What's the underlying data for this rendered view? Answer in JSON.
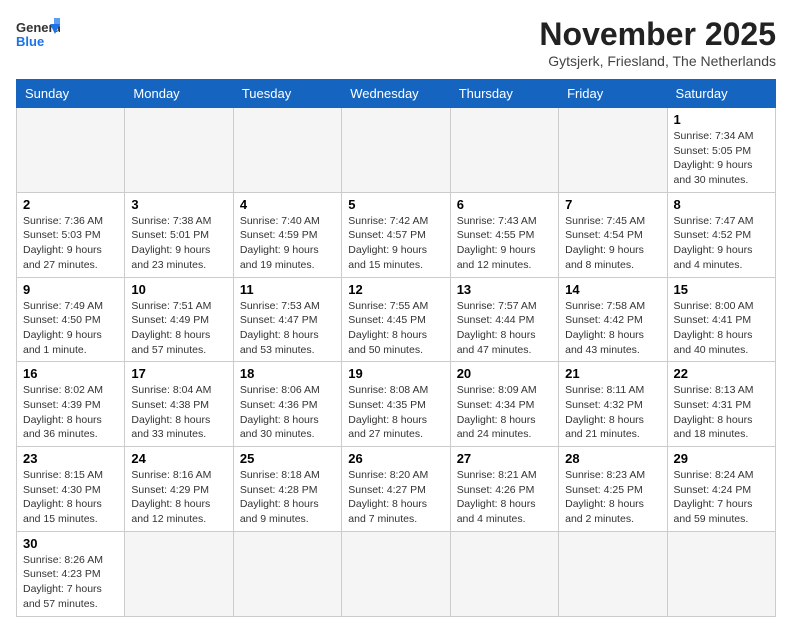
{
  "header": {
    "logo_general": "General",
    "logo_blue": "Blue",
    "month": "November 2025",
    "location": "Gytsjerk, Friesland, The Netherlands"
  },
  "weekdays": [
    "Sunday",
    "Monday",
    "Tuesday",
    "Wednesday",
    "Thursday",
    "Friday",
    "Saturday"
  ],
  "weeks": [
    [
      {
        "day": null,
        "info": ""
      },
      {
        "day": null,
        "info": ""
      },
      {
        "day": null,
        "info": ""
      },
      {
        "day": null,
        "info": ""
      },
      {
        "day": null,
        "info": ""
      },
      {
        "day": null,
        "info": ""
      },
      {
        "day": "1",
        "info": "Sunrise: 7:34 AM\nSunset: 5:05 PM\nDaylight: 9 hours\nand 30 minutes."
      }
    ],
    [
      {
        "day": "2",
        "info": "Sunrise: 7:36 AM\nSunset: 5:03 PM\nDaylight: 9 hours\nand 27 minutes."
      },
      {
        "day": "3",
        "info": "Sunrise: 7:38 AM\nSunset: 5:01 PM\nDaylight: 9 hours\nand 23 minutes."
      },
      {
        "day": "4",
        "info": "Sunrise: 7:40 AM\nSunset: 4:59 PM\nDaylight: 9 hours\nand 19 minutes."
      },
      {
        "day": "5",
        "info": "Sunrise: 7:42 AM\nSunset: 4:57 PM\nDaylight: 9 hours\nand 15 minutes."
      },
      {
        "day": "6",
        "info": "Sunrise: 7:43 AM\nSunset: 4:55 PM\nDaylight: 9 hours\nand 12 minutes."
      },
      {
        "day": "7",
        "info": "Sunrise: 7:45 AM\nSunset: 4:54 PM\nDaylight: 9 hours\nand 8 minutes."
      },
      {
        "day": "8",
        "info": "Sunrise: 7:47 AM\nSunset: 4:52 PM\nDaylight: 9 hours\nand 4 minutes."
      }
    ],
    [
      {
        "day": "9",
        "info": "Sunrise: 7:49 AM\nSunset: 4:50 PM\nDaylight: 9 hours\nand 1 minute."
      },
      {
        "day": "10",
        "info": "Sunrise: 7:51 AM\nSunset: 4:49 PM\nDaylight: 8 hours\nand 57 minutes."
      },
      {
        "day": "11",
        "info": "Sunrise: 7:53 AM\nSunset: 4:47 PM\nDaylight: 8 hours\nand 53 minutes."
      },
      {
        "day": "12",
        "info": "Sunrise: 7:55 AM\nSunset: 4:45 PM\nDaylight: 8 hours\nand 50 minutes."
      },
      {
        "day": "13",
        "info": "Sunrise: 7:57 AM\nSunset: 4:44 PM\nDaylight: 8 hours\nand 47 minutes."
      },
      {
        "day": "14",
        "info": "Sunrise: 7:58 AM\nSunset: 4:42 PM\nDaylight: 8 hours\nand 43 minutes."
      },
      {
        "day": "15",
        "info": "Sunrise: 8:00 AM\nSunset: 4:41 PM\nDaylight: 8 hours\nand 40 minutes."
      }
    ],
    [
      {
        "day": "16",
        "info": "Sunrise: 8:02 AM\nSunset: 4:39 PM\nDaylight: 8 hours\nand 36 minutes."
      },
      {
        "day": "17",
        "info": "Sunrise: 8:04 AM\nSunset: 4:38 PM\nDaylight: 8 hours\nand 33 minutes."
      },
      {
        "day": "18",
        "info": "Sunrise: 8:06 AM\nSunset: 4:36 PM\nDaylight: 8 hours\nand 30 minutes."
      },
      {
        "day": "19",
        "info": "Sunrise: 8:08 AM\nSunset: 4:35 PM\nDaylight: 8 hours\nand 27 minutes."
      },
      {
        "day": "20",
        "info": "Sunrise: 8:09 AM\nSunset: 4:34 PM\nDaylight: 8 hours\nand 24 minutes."
      },
      {
        "day": "21",
        "info": "Sunrise: 8:11 AM\nSunset: 4:32 PM\nDaylight: 8 hours\nand 21 minutes."
      },
      {
        "day": "22",
        "info": "Sunrise: 8:13 AM\nSunset: 4:31 PM\nDaylight: 8 hours\nand 18 minutes."
      }
    ],
    [
      {
        "day": "23",
        "info": "Sunrise: 8:15 AM\nSunset: 4:30 PM\nDaylight: 8 hours\nand 15 minutes."
      },
      {
        "day": "24",
        "info": "Sunrise: 8:16 AM\nSunset: 4:29 PM\nDaylight: 8 hours\nand 12 minutes."
      },
      {
        "day": "25",
        "info": "Sunrise: 8:18 AM\nSunset: 4:28 PM\nDaylight: 8 hours\nand 9 minutes."
      },
      {
        "day": "26",
        "info": "Sunrise: 8:20 AM\nSunset: 4:27 PM\nDaylight: 8 hours\nand 7 minutes."
      },
      {
        "day": "27",
        "info": "Sunrise: 8:21 AM\nSunset: 4:26 PM\nDaylight: 8 hours\nand 4 minutes."
      },
      {
        "day": "28",
        "info": "Sunrise: 8:23 AM\nSunset: 4:25 PM\nDaylight: 8 hours\nand 2 minutes."
      },
      {
        "day": "29",
        "info": "Sunrise: 8:24 AM\nSunset: 4:24 PM\nDaylight: 7 hours\nand 59 minutes."
      }
    ],
    [
      {
        "day": "30",
        "info": "Sunrise: 8:26 AM\nSunset: 4:23 PM\nDaylight: 7 hours\nand 57 minutes."
      },
      {
        "day": null,
        "info": ""
      },
      {
        "day": null,
        "info": ""
      },
      {
        "day": null,
        "info": ""
      },
      {
        "day": null,
        "info": ""
      },
      {
        "day": null,
        "info": ""
      },
      {
        "day": null,
        "info": ""
      }
    ]
  ]
}
